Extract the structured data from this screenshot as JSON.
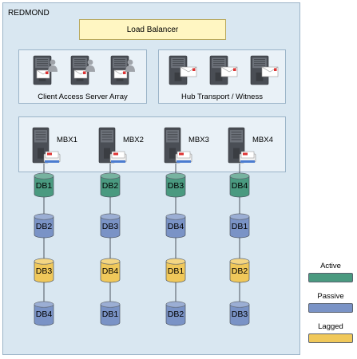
{
  "site": {
    "label": "REDMOND"
  },
  "load_balancer": {
    "label": "Load Balancer"
  },
  "cas_array": {
    "label": "Client Access Server Array"
  },
  "hub_transport": {
    "label": "Hub Transport / Witness"
  },
  "mailbox_servers": [
    {
      "name": "MBX1",
      "databases": [
        {
          "label": "DB1",
          "state": "active"
        },
        {
          "label": "DB2",
          "state": "passive"
        },
        {
          "label": "DB3",
          "state": "lagged"
        },
        {
          "label": "DB4",
          "state": "passive"
        }
      ]
    },
    {
      "name": "MBX2",
      "databases": [
        {
          "label": "DB2",
          "state": "active"
        },
        {
          "label": "DB3",
          "state": "passive"
        },
        {
          "label": "DB4",
          "state": "lagged"
        },
        {
          "label": "DB1",
          "state": "passive"
        }
      ]
    },
    {
      "name": "MBX3",
      "databases": [
        {
          "label": "DB3",
          "state": "active"
        },
        {
          "label": "DB4",
          "state": "passive"
        },
        {
          "label": "DB1",
          "state": "lagged"
        },
        {
          "label": "DB2",
          "state": "passive"
        }
      ]
    },
    {
      "name": "MBX4",
      "databases": [
        {
          "label": "DB4",
          "state": "active"
        },
        {
          "label": "DB1",
          "state": "passive"
        },
        {
          "label": "DB2",
          "state": "lagged"
        },
        {
          "label": "DB3",
          "state": "passive"
        }
      ]
    }
  ],
  "legend": [
    {
      "label": "Active",
      "state": "active",
      "color": "#4a9a80"
    },
    {
      "label": "Passive",
      "state": "passive",
      "color": "#7a93c6"
    },
    {
      "label": "Lagged",
      "state": "lagged",
      "color": "#f0c85a"
    }
  ],
  "colors": {
    "active": "#4a9a80",
    "passive": "#7a93c6",
    "lagged": "#f0c85a"
  },
  "icons": {
    "cas": "server-with-user-icon",
    "hub": "server-with-mail-icon",
    "mailbox": "server-with-mailbox-icon",
    "database": "database-cylinder-icon"
  }
}
